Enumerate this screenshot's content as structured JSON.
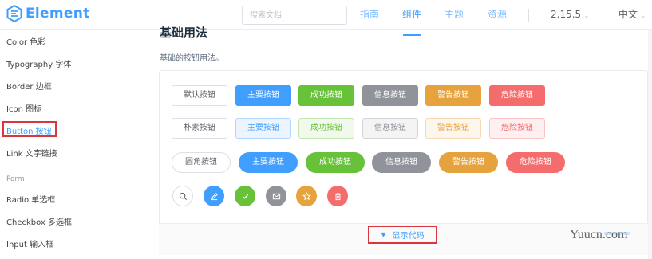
{
  "header": {
    "logo_text": "Element",
    "search_placeholder": "搜索文档",
    "nav": [
      {
        "label": "指南",
        "active": false
      },
      {
        "label": "组件",
        "active": true
      },
      {
        "label": "主题",
        "active": false
      },
      {
        "label": "资源",
        "active": false
      }
    ],
    "version": "2.15.5",
    "language": "中文"
  },
  "sidebar": {
    "items": [
      {
        "label": "Color 色彩"
      },
      {
        "label": "Typography 字体"
      },
      {
        "label": "Border 边框"
      },
      {
        "label": "Icon 图标"
      },
      {
        "label": "Button 按钮",
        "active": true
      },
      {
        "label": "Link 文字链接"
      }
    ],
    "group_label": "Form",
    "form_items": [
      {
        "label": "Radio 单选框"
      },
      {
        "label": "Checkbox 多选框"
      },
      {
        "label": "Input 输入框"
      }
    ]
  },
  "main": {
    "section_title": "基础用法",
    "description": "基础的按钮用法。",
    "row_default": [
      "默认按钮",
      "主要按钮",
      "成功按钮",
      "信息按钮",
      "警告按钮",
      "危险按钮"
    ],
    "row_plain": [
      "朴素按钮",
      "主要按钮",
      "成功按钮",
      "信息按钮",
      "警告按钮",
      "危险按钮"
    ],
    "row_round": [
      "圆角按钮",
      "主要按钮",
      "成功按钮",
      "信息按钮",
      "警告按钮",
      "危险按钮"
    ],
    "row_circle_icons": [
      "search-icon",
      "edit-icon",
      "check-icon",
      "message-icon",
      "star-icon",
      "delete-icon"
    ],
    "show_code": "显示代码"
  },
  "watermark": "Yuucn.com",
  "colors": {
    "primary": "#409eff",
    "success": "#67c23a",
    "info": "#909399",
    "warning": "#e6a23c",
    "danger": "#f56c6c",
    "highlight": "#d9363e"
  }
}
